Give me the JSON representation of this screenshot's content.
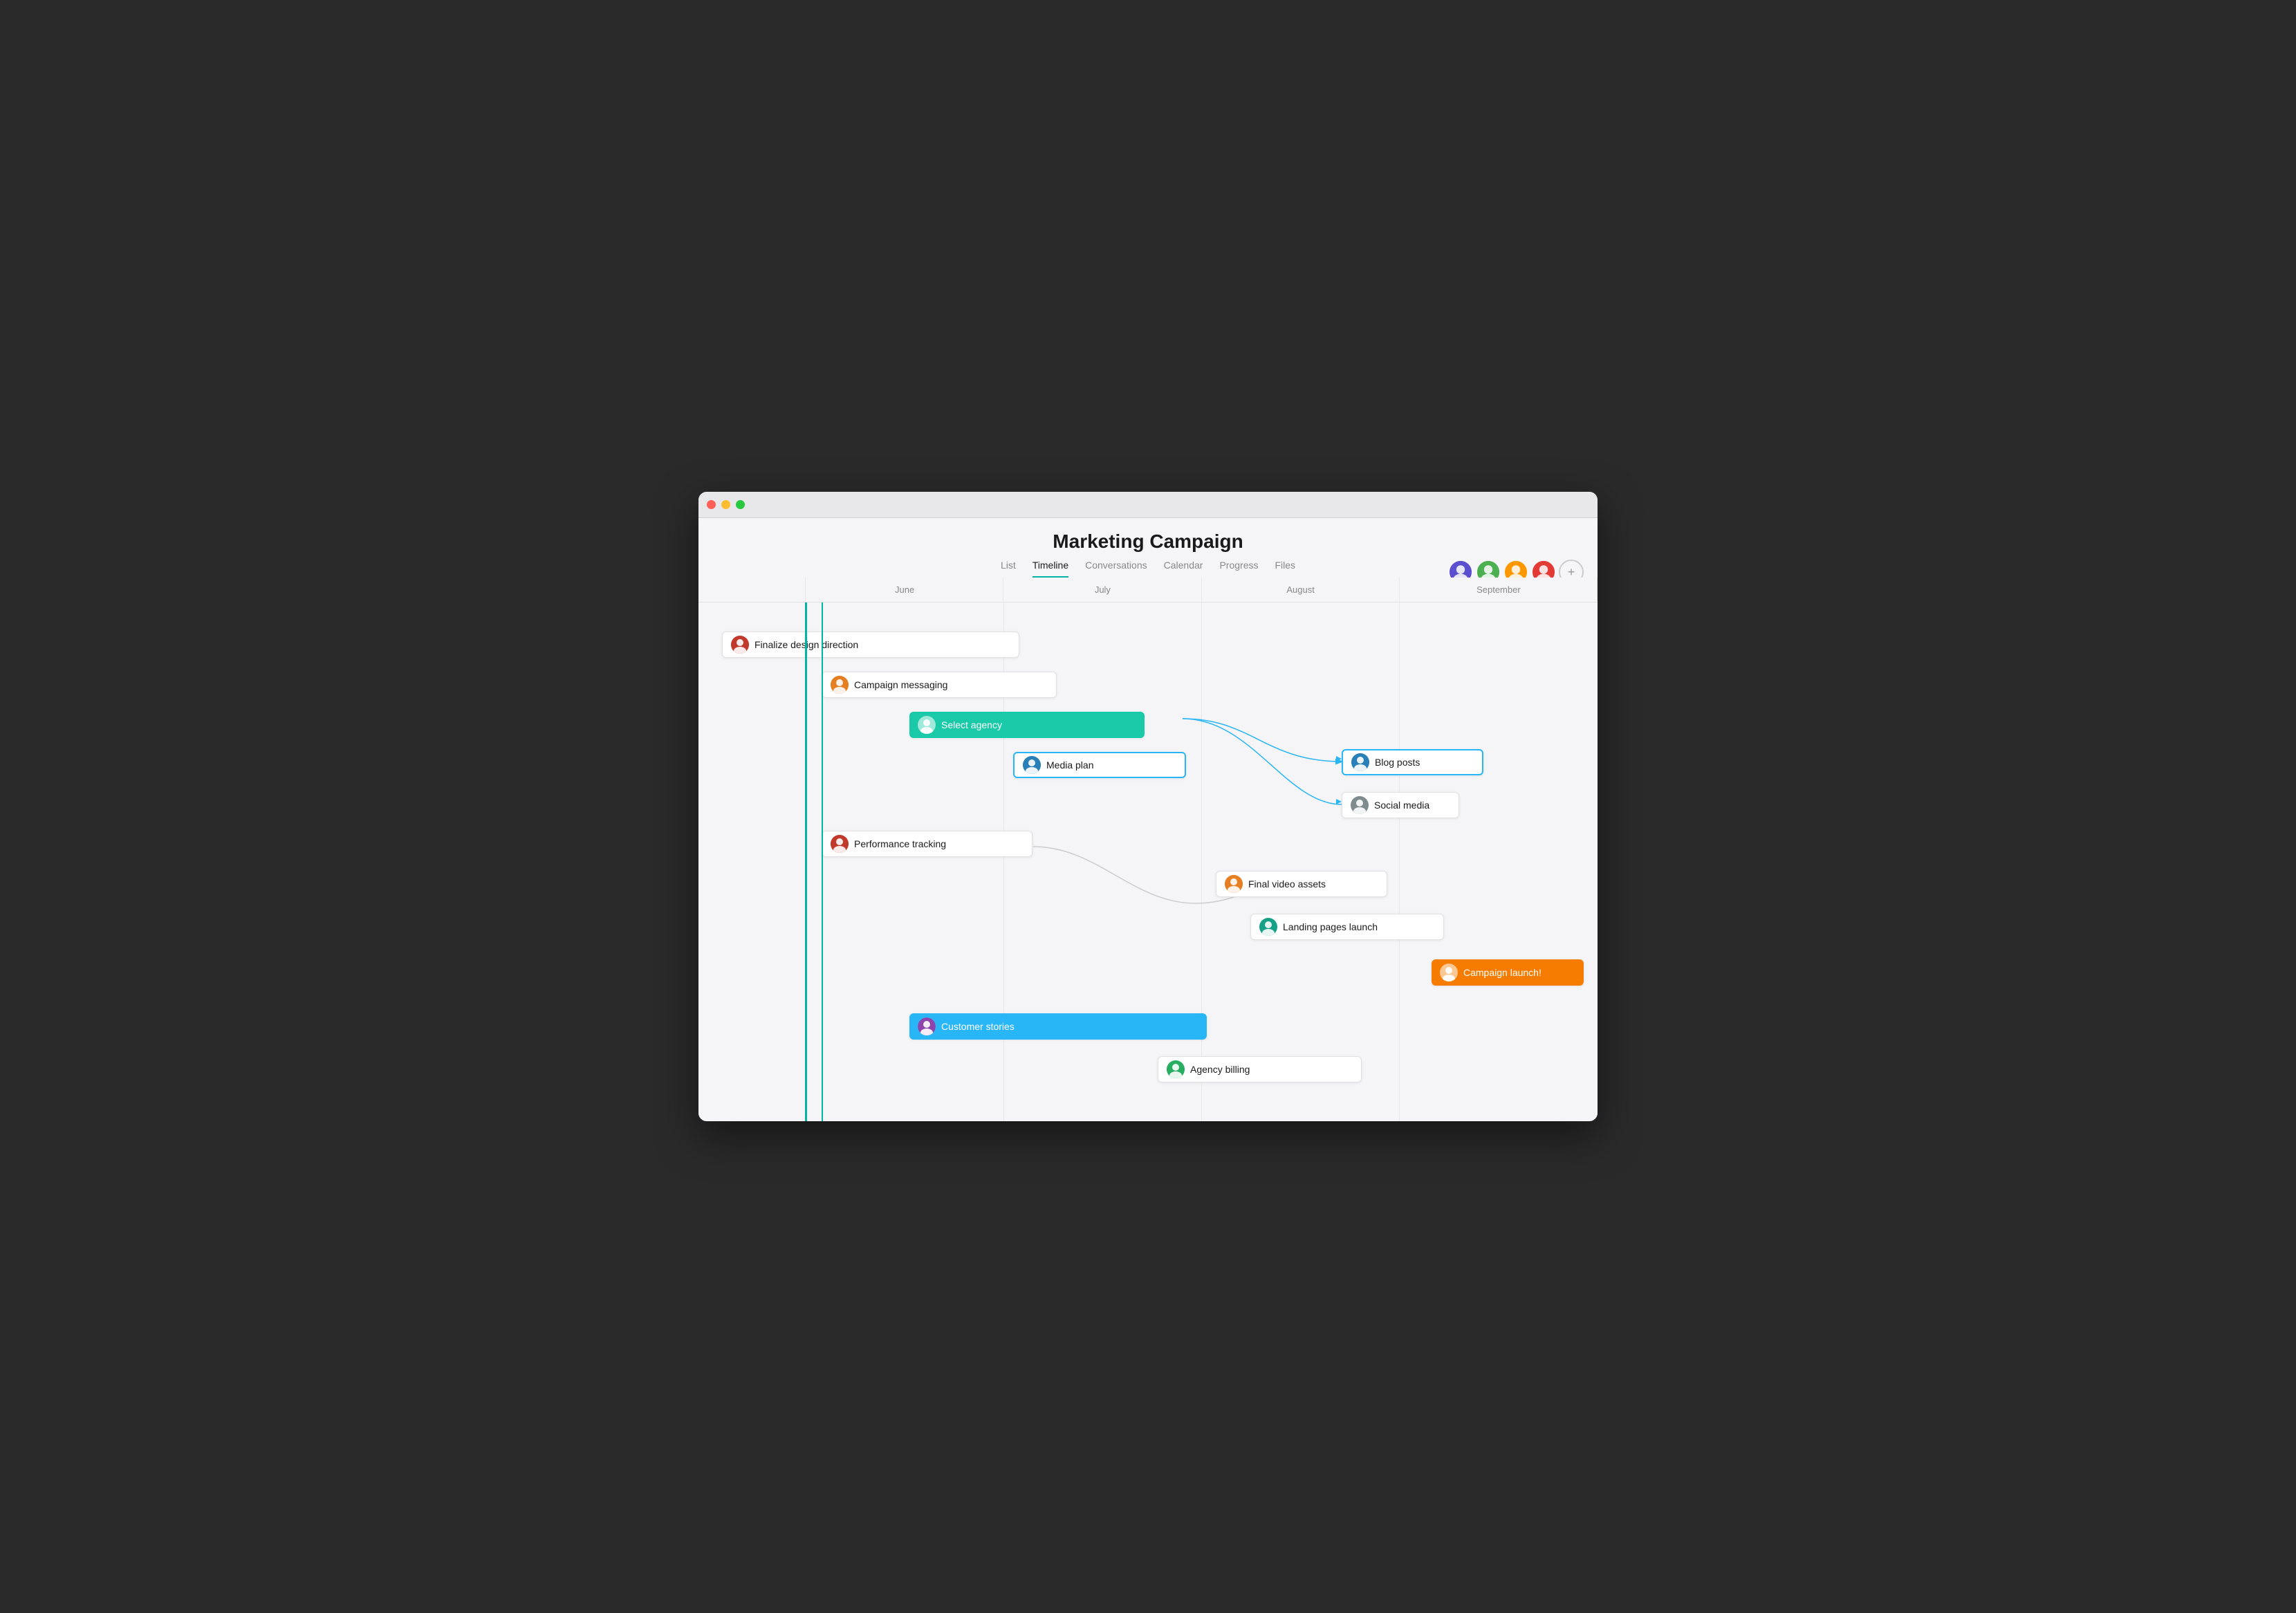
{
  "window": {
    "title": "Marketing Campaign"
  },
  "header": {
    "title": "Marketing Campaign",
    "tabs": [
      {
        "label": "List",
        "active": false
      },
      {
        "label": "Timeline",
        "active": true
      },
      {
        "label": "Conversations",
        "active": false
      },
      {
        "label": "Calendar",
        "active": false
      },
      {
        "label": "Progress",
        "active": false
      },
      {
        "label": "Files",
        "active": false
      }
    ],
    "add_label": "+"
  },
  "months": [
    "June",
    "July",
    "August",
    "September"
  ],
  "tasks": [
    {
      "id": "finalize-design",
      "label": "Finalize design direction",
      "style": "outlined",
      "avatar_color": "face-red"
    },
    {
      "id": "campaign-messaging",
      "label": "Campaign messaging",
      "style": "outlined",
      "avatar_color": "face-orange"
    },
    {
      "id": "select-agency",
      "label": "Select agency",
      "style": "teal",
      "avatar_color": "face-teal"
    },
    {
      "id": "media-plan",
      "label": "Media plan",
      "style": "outlined-blue",
      "avatar_color": "face-blue"
    },
    {
      "id": "performance-tracking",
      "label": "Performance tracking",
      "style": "outlined",
      "avatar_color": "face-red"
    },
    {
      "id": "blog-posts",
      "label": "Blog posts",
      "style": "outlined-blue",
      "avatar_color": "face-blue"
    },
    {
      "id": "social-media",
      "label": "Social media",
      "style": "outlined",
      "avatar_color": "face-gray"
    },
    {
      "id": "final-video",
      "label": "Final video assets",
      "style": "outlined",
      "avatar_color": "face-orange"
    },
    {
      "id": "landing-pages",
      "label": "Landing pages launch",
      "style": "outlined",
      "avatar_color": "face-teal"
    },
    {
      "id": "campaign-launch",
      "label": "Campaign launch!",
      "style": "orange",
      "avatar_color": "face-red"
    },
    {
      "id": "customer-stories",
      "label": "Customer stories",
      "style": "blue",
      "avatar_color": "face-purple"
    },
    {
      "id": "agency-billing",
      "label": "Agency billing",
      "style": "outlined",
      "avatar_color": "face-green"
    }
  ]
}
